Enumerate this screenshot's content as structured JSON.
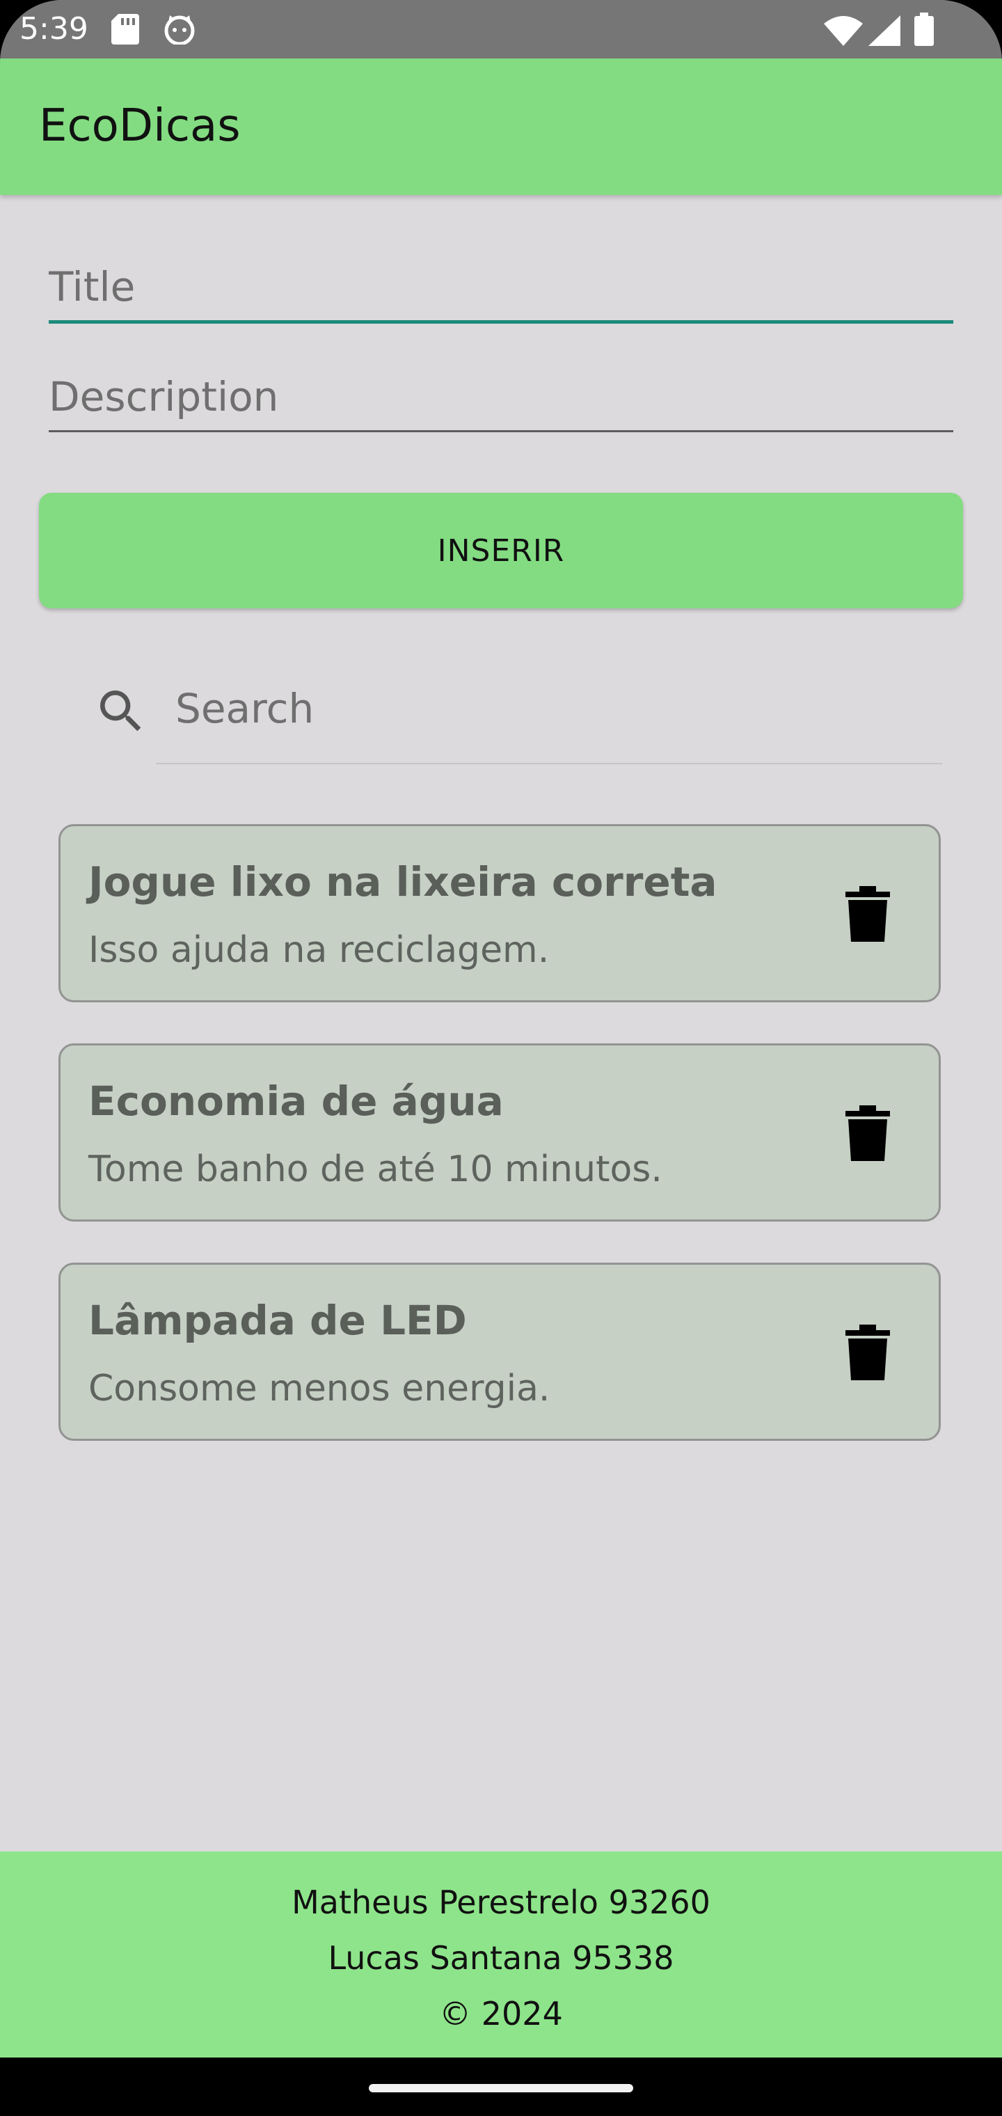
{
  "status_bar": {
    "time": "5:39",
    "icons": [
      "sd-card-icon",
      "cat-face-icon",
      "wifi-icon",
      "signal-icon",
      "battery-icon"
    ]
  },
  "app_bar": {
    "title": "EcoDicas",
    "color": "#83dc82"
  },
  "form": {
    "title_placeholder": "Title",
    "description_placeholder": "Description",
    "insert_label": "INSERIR",
    "focus_color": "#1b8a7a"
  },
  "search": {
    "placeholder": "Search",
    "icon": "search-icon"
  },
  "tips": [
    {
      "title": "Jogue lixo na lixeira correta",
      "description": "Isso ajuda na reciclagem.",
      "icon": "trash-icon"
    },
    {
      "title": "Economia de água",
      "description": "Tome banho de até 10 minutos.",
      "icon": "trash-icon"
    },
    {
      "title": "Lâmpada de LED",
      "description": "Consome menos energia.",
      "icon": "trash-icon"
    }
  ],
  "footer": {
    "line1": "Matheus Perestrelo 93260",
    "line2": "Lucas Santana 95338",
    "line3": "© 2024",
    "color": "#8ee48a"
  }
}
